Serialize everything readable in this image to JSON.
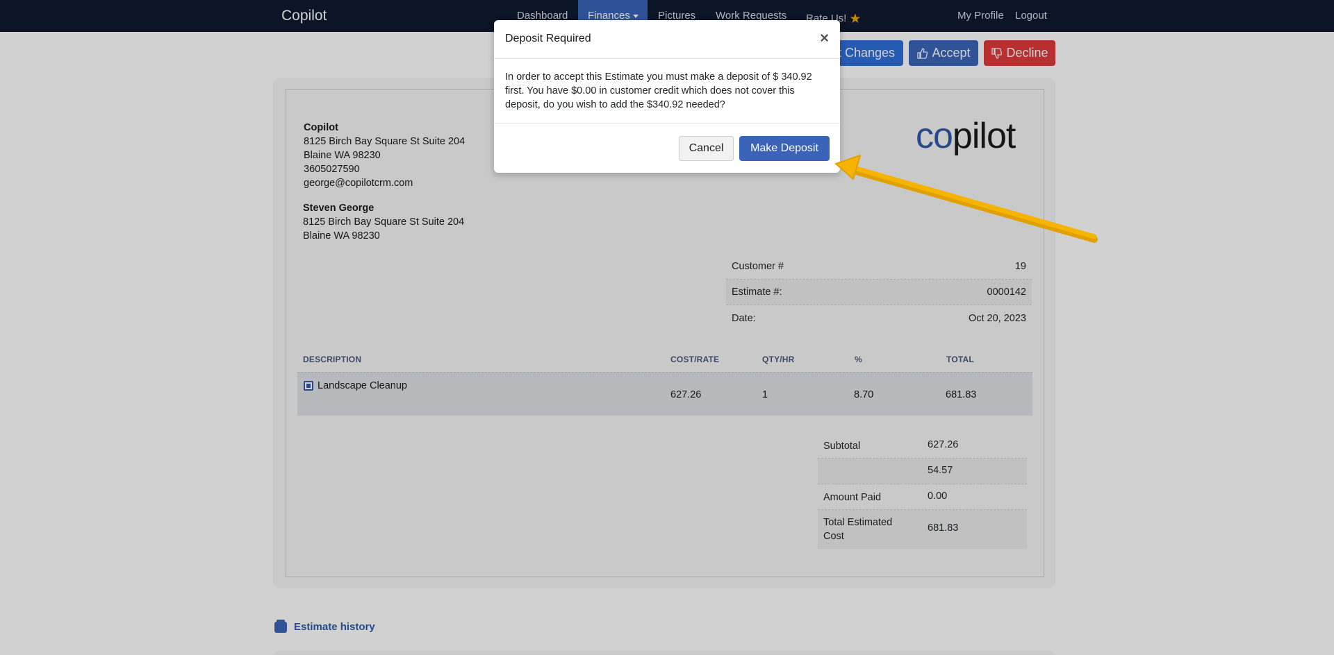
{
  "navbar": {
    "brand": "Copilot",
    "links": [
      "Dashboard",
      "Finances",
      "Pictures",
      "Work Requests",
      "Rate Us!"
    ],
    "right_links": [
      "My Profile",
      "Logout"
    ]
  },
  "actions": {
    "changes_label": "t Changes",
    "accept_label": "Accept",
    "decline_label": "Decline"
  },
  "company": {
    "name": "Copilot",
    "address1": "8125 Birch Bay Square St Suite 204",
    "address2": "Blaine WA 98230",
    "phone": "3605027590",
    "email": "george@copilotcrm.com"
  },
  "customer": {
    "name": "Steven George",
    "address1": "8125 Birch Bay Square St Suite 204",
    "address2": "Blaine WA 98230"
  },
  "logo": {
    "part1": "co",
    "part2": "pilot"
  },
  "meta": [
    {
      "label": "Customer #",
      "value": "19"
    },
    {
      "label": "Estimate #:",
      "value": "0000142"
    },
    {
      "label": "Date:",
      "value": "Oct 20, 2023"
    }
  ],
  "table": {
    "headers": [
      "DESCRIPTION",
      "COST/RATE",
      "QTY/HR",
      "%",
      "TOTAL"
    ],
    "rows": [
      {
        "description": "Landscape Cleanup",
        "cost": "627.26",
        "qty": "1",
        "pct": "8.70",
        "total": "681.83"
      }
    ]
  },
  "totals": [
    {
      "label": "Subtotal",
      "value": "627.26"
    },
    {
      "label": "",
      "value": "54.57"
    },
    {
      "label": "Amount Paid",
      "value": "0.00"
    },
    {
      "label": "Total Estimated Cost",
      "value": "681.83"
    }
  ],
  "history_label": "Estimate history",
  "modal": {
    "title": "Deposit Required",
    "close": "×",
    "body": "In order to accept this Estimate you must make a deposit of $ 340.92 first. You have $0.00 in customer credit which does not cover this deposit, do you wish to add the $340.92 needed?",
    "cancel_label": "Cancel",
    "deposit_label": "Make Deposit"
  },
  "colors": {
    "navbar": "#0f1a30",
    "primary": "#3b64b8",
    "danger": "#e03a3a",
    "arrow": "#f5b400"
  },
  "icons": [
    "caret-down-icon",
    "star-icon",
    "thumbs-up-icon",
    "thumbs-down-icon",
    "checkbox-icon",
    "history-icon",
    "close-icon"
  ]
}
